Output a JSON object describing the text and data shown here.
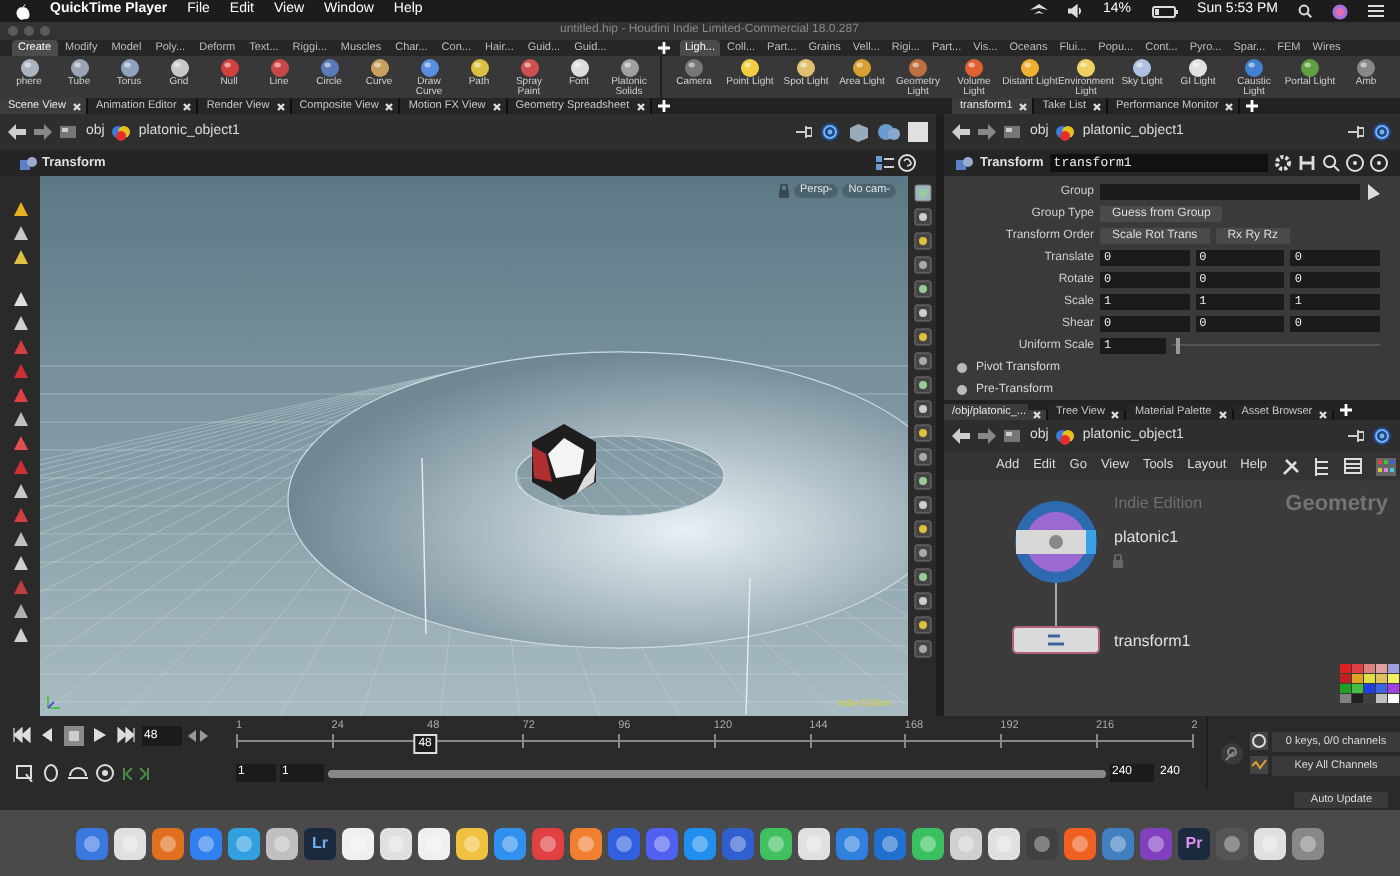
{
  "menu_bar": {
    "app": "QuickTime Player",
    "items": [
      "File",
      "Edit",
      "View",
      "Window",
      "Help"
    ],
    "battery": "14%",
    "clock": "Sun 5:53 PM"
  },
  "window": {
    "title": "untitled.hip - Houdini Indie Limited-Commercial 18.0.287"
  },
  "shelf_tabs_left": [
    {
      "label": "Create",
      "selected": true
    },
    {
      "label": "Modify",
      "selected": false
    },
    {
      "label": "Model",
      "selected": false
    },
    {
      "label": "Poly...",
      "selected": false
    },
    {
      "label": "Deform",
      "selected": false
    },
    {
      "label": "Text...",
      "selected": false
    },
    {
      "label": "Riggi...",
      "selected": false
    },
    {
      "label": "Muscles",
      "selected": false
    },
    {
      "label": "Char...",
      "selected": false
    },
    {
      "label": "Con...",
      "selected": false
    },
    {
      "label": "Hair...",
      "selected": false
    },
    {
      "label": "Guid...",
      "selected": false
    },
    {
      "label": "Guid...",
      "selected": false
    }
  ],
  "shelf_tabs_right": [
    {
      "label": "Ligh...",
      "selected": true
    },
    {
      "label": "Coll...",
      "selected": false
    },
    {
      "label": "Part...",
      "selected": false
    },
    {
      "label": "Grains",
      "selected": false
    },
    {
      "label": "Vell...",
      "selected": false
    },
    {
      "label": "Rigi...",
      "selected": false
    },
    {
      "label": "Part...",
      "selected": false
    },
    {
      "label": "Vis...",
      "selected": false
    },
    {
      "label": "Oceans",
      "selected": false
    },
    {
      "label": "Flui...",
      "selected": false
    },
    {
      "label": "Popu...",
      "selected": false
    },
    {
      "label": "Cont...",
      "selected": false
    },
    {
      "label": "Pyro...",
      "selected": false
    },
    {
      "label": "Spar...",
      "selected": false
    },
    {
      "label": "FEM",
      "selected": false
    },
    {
      "label": "Wires",
      "selected": false
    }
  ],
  "shelf_tools_left": [
    "phere",
    "Tube",
    "Torus",
    "Grid",
    "Null",
    "Line",
    "Circle",
    "Curve",
    "Draw Curve",
    "Path",
    "Spray Paint",
    "Font",
    "Platonic Solids"
  ],
  "shelf_tools_right": [
    "Camera",
    "Point Light",
    "Spot Light",
    "Area Light",
    "Geometry Light",
    "Volume Light",
    "Distant Light",
    "Environment Light",
    "Sky Light",
    "GI Light",
    "Caustic Light",
    "Portal Light",
    "Amb"
  ],
  "pane_tabs_left": [
    {
      "label": "Scene View",
      "selected": true
    },
    {
      "label": "Animation Editor",
      "selected": false
    },
    {
      "label": "Render View",
      "selected": false
    },
    {
      "label": "Composite View",
      "selected": false
    },
    {
      "label": "Motion FX View",
      "selected": false
    },
    {
      "label": "Geometry Spreadsheet",
      "selected": false
    }
  ],
  "pane_tabs_right": [
    {
      "label": "transform1",
      "selected": true
    },
    {
      "label": "Take List",
      "selected": false
    },
    {
      "label": "Performance Monitor",
      "selected": false
    }
  ],
  "scene_view": {
    "path": [
      "obj",
      "platonic_object1"
    ],
    "tool": "Transform",
    "view_buttons": [
      "Persp-",
      "No cam-"
    ],
    "edition": "Indie Edition"
  },
  "parameters": {
    "path": [
      "obj",
      "platonic_object1"
    ],
    "node_type": "Transform",
    "node_name": "transform1",
    "rows": [
      {
        "kind": "field",
        "label": "Group"
      },
      {
        "kind": "menu",
        "label": "Group Type",
        "values": [
          "Guess from Group"
        ]
      },
      {
        "kind": "menu",
        "label": "Transform Order",
        "values": [
          "Scale Rot Trans",
          "Rx Ry Rz"
        ]
      },
      {
        "kind": "vector",
        "label": "Translate",
        "values": [
          "0",
          "0",
          "0"
        ]
      },
      {
        "kind": "vector",
        "label": "Rotate",
        "values": [
          "0",
          "0",
          "0"
        ]
      },
      {
        "kind": "vector",
        "label": "Scale",
        "values": [
          "1",
          "1",
          "1"
        ]
      },
      {
        "kind": "vector",
        "label": "Shear",
        "values": [
          "0",
          "0",
          "0"
        ]
      },
      {
        "kind": "slider",
        "label": "Uniform Scale",
        "values": [
          "1"
        ],
        "level": 0.02
      },
      {
        "kind": "folder",
        "label": "Pivot Transform"
      },
      {
        "kind": "folder",
        "label": "Pre-Transform"
      }
    ]
  },
  "network_tabs": [
    {
      "label": "/obj/platonic_...",
      "selected": true
    },
    {
      "label": "Tree View",
      "selected": false
    },
    {
      "label": "Material Palette",
      "selected": false
    },
    {
      "label": "Asset Browser",
      "selected": false
    }
  ],
  "network": {
    "path": [
      "obj",
      "platonic_object1"
    ],
    "menu": [
      "Add",
      "Edit",
      "Go",
      "View",
      "Tools",
      "Layout",
      "Help"
    ],
    "edition": "Indie Edition",
    "context": "Geometry",
    "nodes": [
      {
        "name": "platonic1",
        "kind": "generator"
      },
      {
        "name": "transform1",
        "kind": "modifier"
      }
    ]
  },
  "timeline": {
    "frame": "48",
    "ticks": [
      "1",
      "24",
      "48",
      "72",
      "96",
      "120",
      "144",
      "168",
      "192",
      "216",
      "2"
    ],
    "playhead": {
      "label": "48",
      "level": 0.2
    },
    "range": [
      "1",
      "1",
      "240",
      "240"
    ],
    "range_bar": {
      "level": 1
    },
    "keys": "0 keys, 0/0 channels",
    "key_all": "Key All Channels",
    "auto_update": "Auto Update"
  },
  "dock": {
    "lettered": [
      "Lr",
      "Pr"
    ]
  }
}
